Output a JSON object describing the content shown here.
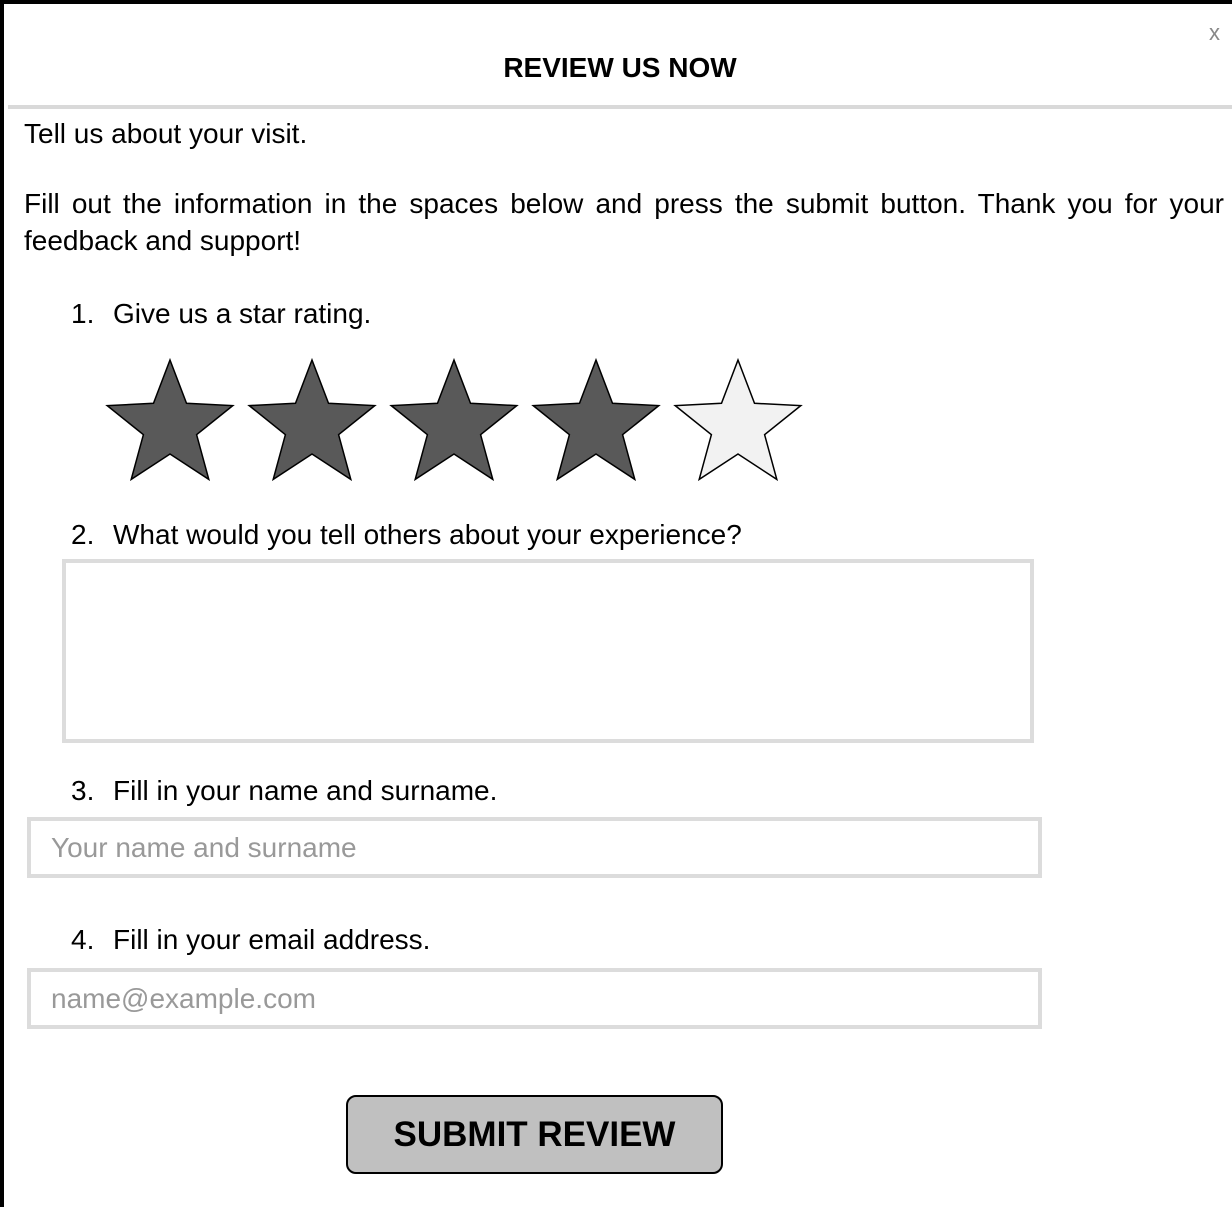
{
  "dialog": {
    "title": "REVIEW US NOW",
    "close_label": "x",
    "intro": "Tell us about your visit.",
    "instructions": "Fill out the information in the spaces below and press the submit button. Thank you for your feedback and support!"
  },
  "questions": {
    "rating": {
      "number": "1.",
      "label": "Give us a star rating.",
      "value": 4,
      "max": 5
    },
    "experience": {
      "number": "2.",
      "label": "What would you tell others about your experience?",
      "value": "",
      "placeholder": ""
    },
    "name": {
      "number": "3.",
      "label": "Fill in your name and surname.",
      "value": "",
      "placeholder": "Your name and surname"
    },
    "email": {
      "number": "4.",
      "label": "Fill in your email address.",
      "value": "",
      "placeholder": "name@example.com"
    }
  },
  "submit": {
    "label": "SUBMIT REVIEW"
  },
  "colors": {
    "star_filled": "#595959",
    "star_empty": "#f2f2f2",
    "field_border": "#dcdcdc",
    "button_bg": "#c0c0c0",
    "placeholder": "#999999"
  },
  "icons": {
    "close": "close-icon",
    "star": "star-icon"
  }
}
